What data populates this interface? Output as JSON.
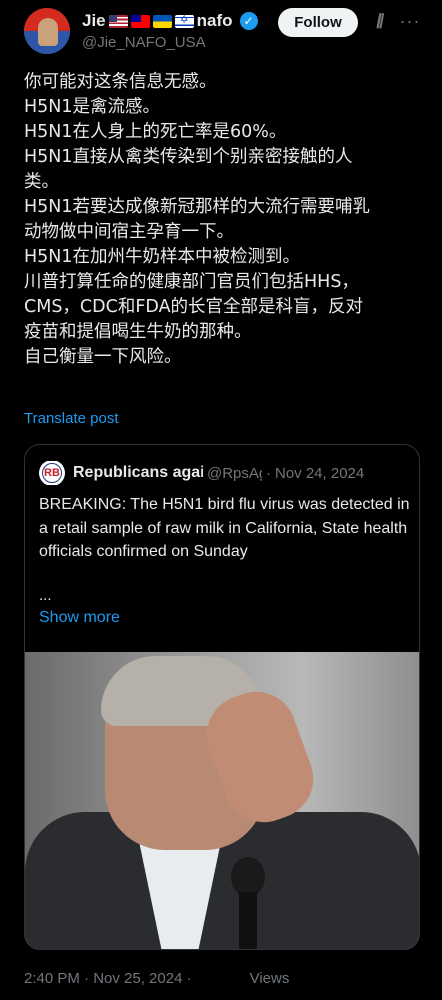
{
  "author": {
    "name_prefix": "Jie",
    "name_suffix": "nafo",
    "flags": [
      "us-flag-icon",
      "taiwan-flag-icon",
      "ukraine-flag-icon",
      "israel-flag-icon"
    ],
    "handle": "@Jie_NAFO_USA",
    "verified": true
  },
  "actions": {
    "follow_label": "Follow",
    "grok_icon": "grok-icon",
    "more_icon": "more-icon"
  },
  "post": {
    "lines": [
      "你可能对这条信息无感。",
      "H5N1是禽流感。",
      "H5N1在人身上的死亡率是60%。",
      "H5N1直接从禽类传染到个别亲密接触的人",
      "类。",
      "H5N1若要达成像新冠那样的大流行需要哺乳",
      "动物做中间宿主孕育一下。",
      "H5N1在加州牛奶样本中被检测到。",
      "川普打算任命的健康部门官员们包括HHS，",
      "CMS，CDC和FDA的长官全部是科盲，反对",
      "疫苗和提倡喝生牛奶的那种。",
      "自己衡量一下风险。"
    ],
    "translate_label": "Translate post"
  },
  "quote": {
    "name": "Republicans against Trump",
    "handle": "@RpsAgainstTrump",
    "date": "Nov 24, 2024",
    "dot": "·",
    "body": "BREAKING: The H5N1 bird flu virus was detected in a retail sample of raw milk in California, State health officials confirmed on Sunday",
    "ellipsis": "...",
    "show_more_label": "Show more",
    "avatar_text": "RB"
  },
  "footer": {
    "timestamp": "2:40 PM · Nov 25, 2024 ·",
    "views_label": "Views"
  }
}
